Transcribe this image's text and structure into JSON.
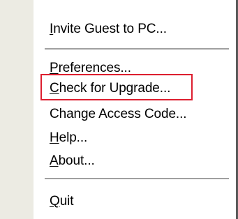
{
  "menu": {
    "items": [
      {
        "mnemonic": "I",
        "rest": "nvite Guest to PC..."
      },
      {
        "mnemonic": "P",
        "rest": "references..."
      },
      {
        "mnemonic": "C",
        "rest": "heck for Upgrade..."
      },
      {
        "mnemonic": "",
        "rest": "Change Access Code..."
      },
      {
        "mnemonic": "H",
        "rest": "elp..."
      },
      {
        "mnemonic": "A",
        "rest": "bout..."
      },
      {
        "mnemonic": "Q",
        "rest": "uit"
      }
    ]
  },
  "highlight": {
    "color": "#dd1e2f",
    "item_index": 2
  },
  "colors": {
    "gutter": "#ecebe3",
    "separator": "#a0a0a0",
    "edge": "#5a5a5a"
  }
}
